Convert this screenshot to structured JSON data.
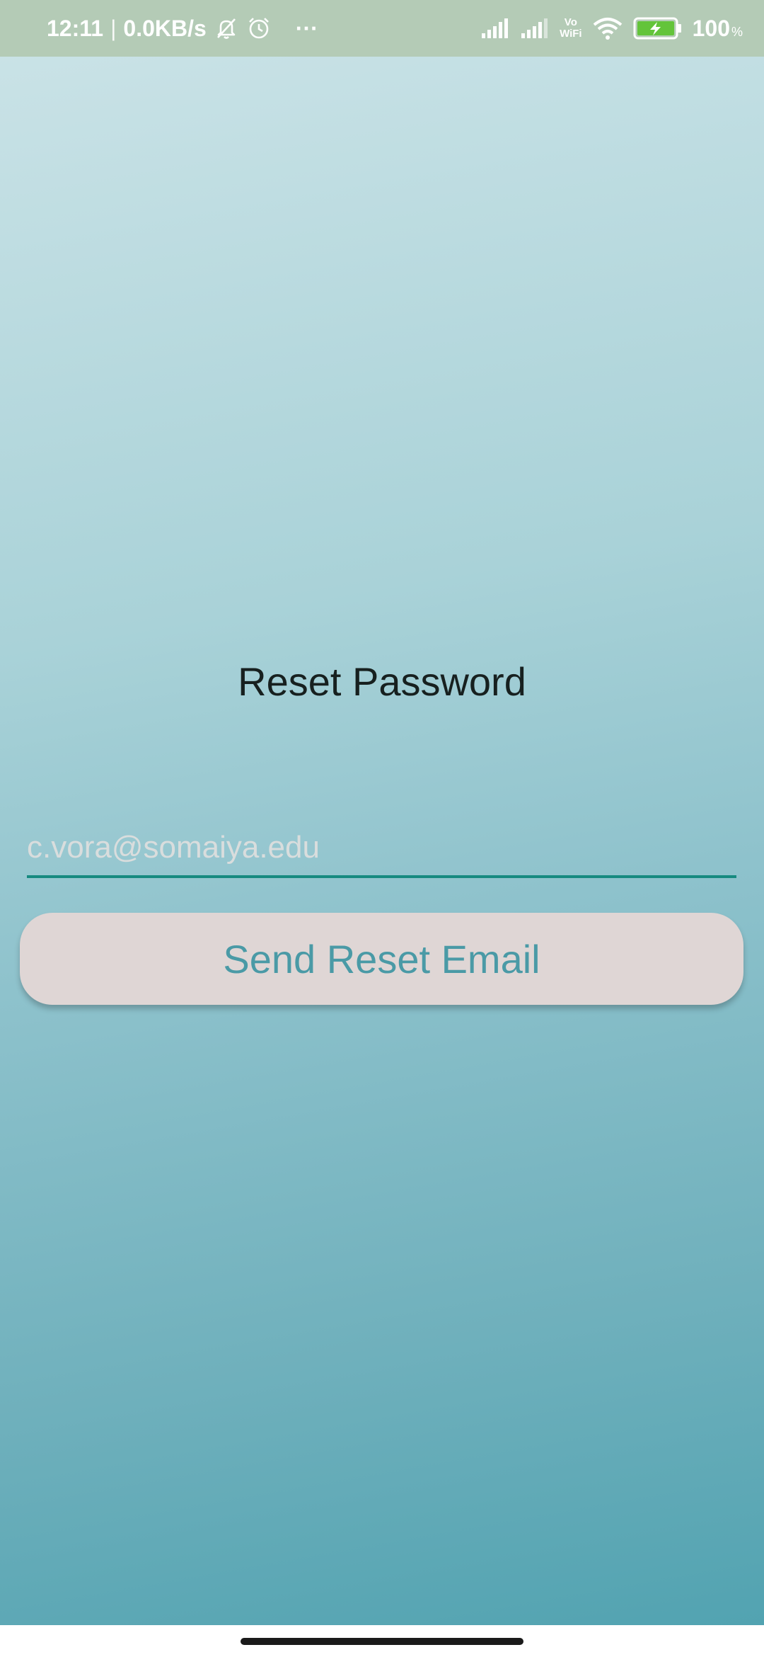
{
  "status_bar": {
    "time": "12:11",
    "separator": "|",
    "network_speed": "0.0KB/s",
    "more": "···",
    "vo_label": "Vo",
    "wifi_label": "WiFi",
    "battery_level": "100",
    "battery_unit": "%",
    "icons": [
      "mute-bell-icon",
      "alarm-icon",
      "signal-icon",
      "signal-icon",
      "vowifi-icon",
      "wifi-icon",
      "battery-charging-icon"
    ],
    "battery_color": "#63c43a"
  },
  "main": {
    "title": "Reset Password",
    "email_placeholder": "c.vora@somaiya.edu",
    "email_value": "",
    "send_button_label": "Send Reset Email"
  },
  "colors": {
    "underline": "#168a80",
    "button_bg": "#dfd6d5",
    "button_text": "#4a9aa6",
    "status_bar_bg": "#b4cbb6"
  }
}
